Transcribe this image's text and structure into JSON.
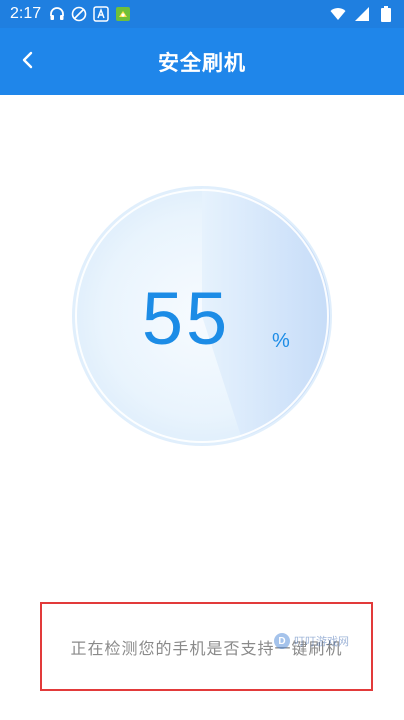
{
  "status_bar": {
    "time": "2:17",
    "left_icons": [
      "headphones-icon",
      "blocked-sync-icon",
      "a-app-icon",
      "game-app-icon"
    ],
    "right_icons": [
      "wifi-icon",
      "cellular-icon",
      "battery-icon"
    ]
  },
  "app_bar": {
    "back_icon": "chevron-left-icon",
    "title": "安全刷机"
  },
  "progress": {
    "value": 55,
    "value_text": "55",
    "unit": "%"
  },
  "status": {
    "message": "正在检测您的手机是否支持一键刷机"
  },
  "watermark": {
    "badge": "D",
    "text": "叮叮游戏网"
  },
  "colors": {
    "primary": "#1f86ea",
    "status_bar": "#1f7fe0",
    "progress_text": "#1c8ce6",
    "highlight_border": "#e23a3a"
  }
}
